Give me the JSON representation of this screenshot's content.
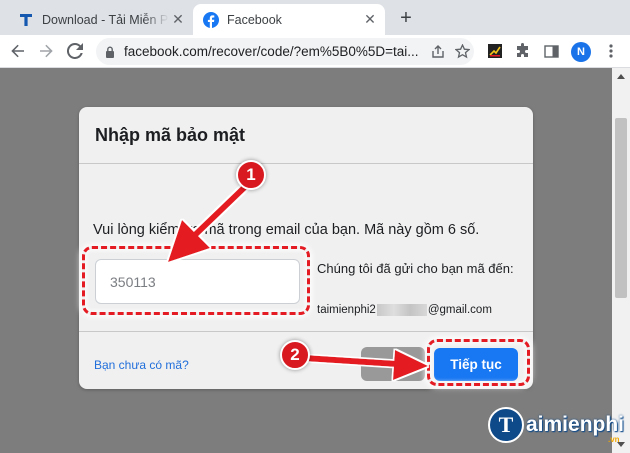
{
  "browser": {
    "tabs": [
      {
        "title": "Download - Tải Miễn Phí VN - Phần mềm",
        "favicon": "taimienphi-t-icon",
        "active": false
      },
      {
        "title": "Facebook",
        "favicon": "facebook-icon",
        "active": true
      }
    ],
    "close_glyph": "✕",
    "new_tab_glyph": "+",
    "url": "facebook.com/recover/code/?em%5B0%5D=tai...",
    "profile_initial": "N"
  },
  "dialog": {
    "title": "Nhập mã bảo mật",
    "instruction": "Vui lòng kiểm tra mã trong email của bạn. Mã này gồm 6 số.",
    "code_value": "350113",
    "sent_label": "Chúng tôi đã gửi cho bạn mã đến:",
    "email_prefix": "taimienphi2",
    "email_suffix": "@gmail.com",
    "no_code_link": "Bạn chưa có mã?",
    "continue_button": "Tiếp tục"
  },
  "annotations": {
    "step_1": "1",
    "step_2": "2",
    "accent_color": "#e41b23"
  },
  "watermark": {
    "logo_letter": "T",
    "text": "aimienphi",
    "suffix": ".vn"
  }
}
